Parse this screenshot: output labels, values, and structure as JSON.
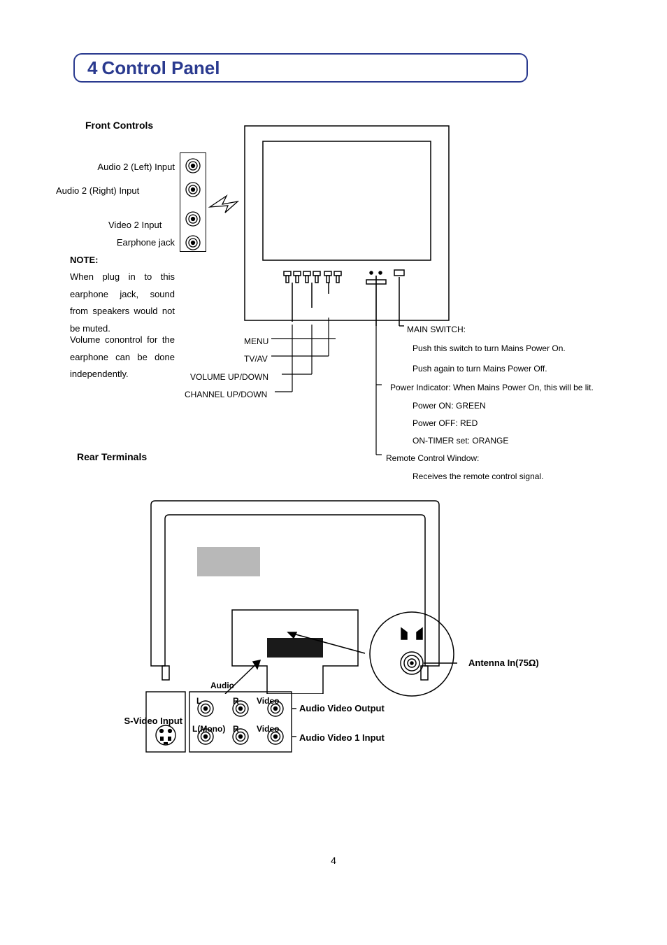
{
  "section": {
    "number": "4",
    "title": "Control Panel"
  },
  "front": {
    "heading": "Front Controls",
    "labels": {
      "audio2_left": "Audio 2 (Left) Input",
      "audio2_right": "Audio 2 (Right) Input",
      "video2": "Video 2 Input",
      "earphone": "Earphone jack"
    },
    "note_heading": "NOTE:",
    "note_body1": "When plug in to this earphone jack, sound from speakers would not be muted.",
    "note_body2": "Volume conontrol for the earphone can be done independently.",
    "button_labels": {
      "menu": "MENU",
      "tvav": "TV/AV",
      "vol": "VOLUME UP/DOWN",
      "ch": "CHANNEL UP/DOWN"
    },
    "right_labels": {
      "main_switch": "MAIN SWITCH:",
      "main_switch_1": "Push this switch to turn Mains Power On.",
      "main_switch_2": "Push again to turn Mains Power Off.",
      "power_indicator": "Power Indicator: When Mains Power On, this will be lit.",
      "power_on": "Power ON: GREEN",
      "power_off": "Power OFF: RED",
      "ontimer": "ON-TIMER set: ORANGE",
      "rcw": "Remote Control Window:",
      "rcw_desc": "Receives the remote control signal."
    }
  },
  "rear": {
    "heading": "Rear Terminals",
    "labels": {
      "audio": "Audio",
      "L": "L",
      "R": "R",
      "Video": "Video",
      "LMono": "L(Mono)",
      "svideo": "S-Video Input",
      "av_out": "Audio Video Output",
      "av1_in": "Audio Video 1 Input",
      "antenna": "Antenna In(75Ω)"
    }
  },
  "page_number": "4"
}
